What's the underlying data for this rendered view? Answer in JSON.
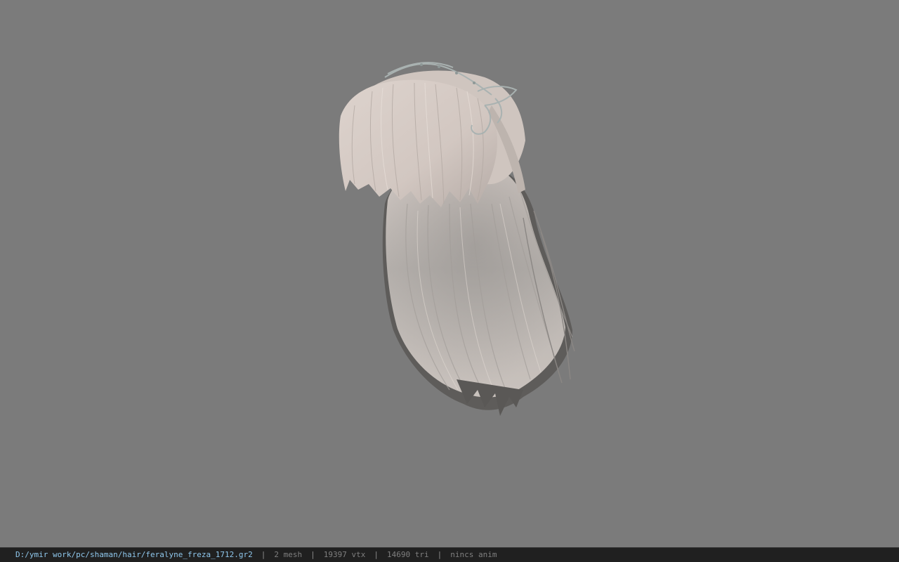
{
  "viewer": {
    "background_color": "#7b7b7b",
    "model_icon": "hair-mesh-icon"
  },
  "status": {
    "file_path": "D:/ymir work/pc/shaman/hair/feralyne_freza_1712.gr2",
    "separator": "|",
    "mesh": "2 mesh",
    "vertices": "19397 vtx",
    "triangles": "14690 tri",
    "anim": "nincs anim",
    "path_color": "#8fc7ec",
    "text_color": "#7f7f7f",
    "bar_color": "#202020"
  }
}
